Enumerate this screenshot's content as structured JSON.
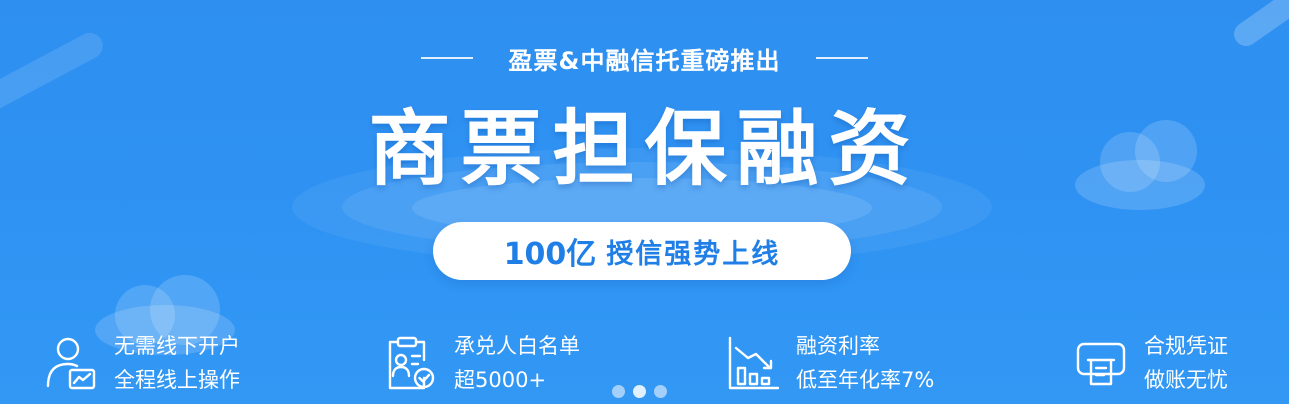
{
  "banner": {
    "subtitle": "盈票&中融信托重磅推出",
    "title": "商票担保融资",
    "pill": {
      "number": "100亿",
      "text": "授信强势上线"
    }
  },
  "features": [
    {
      "icon": "user-chart-icon",
      "line1": "无需线下开户",
      "line2": "全程线上操作"
    },
    {
      "icon": "clipboard-check-icon",
      "line1": "承兑人白名单",
      "line2": "超5000+"
    },
    {
      "icon": "bar-chart-decline-icon",
      "line1": "融资利率",
      "line2": "低至年化率7%"
    },
    {
      "icon": "receipt-printer-icon",
      "line1": "合规凭证",
      "line2": "做账无忧"
    }
  ],
  "carousel": {
    "dot_count": 3,
    "active_index": 1
  },
  "colors": {
    "background": "#2e8ff0",
    "accent": "#1f7fe6",
    "text": "#ffffff"
  }
}
